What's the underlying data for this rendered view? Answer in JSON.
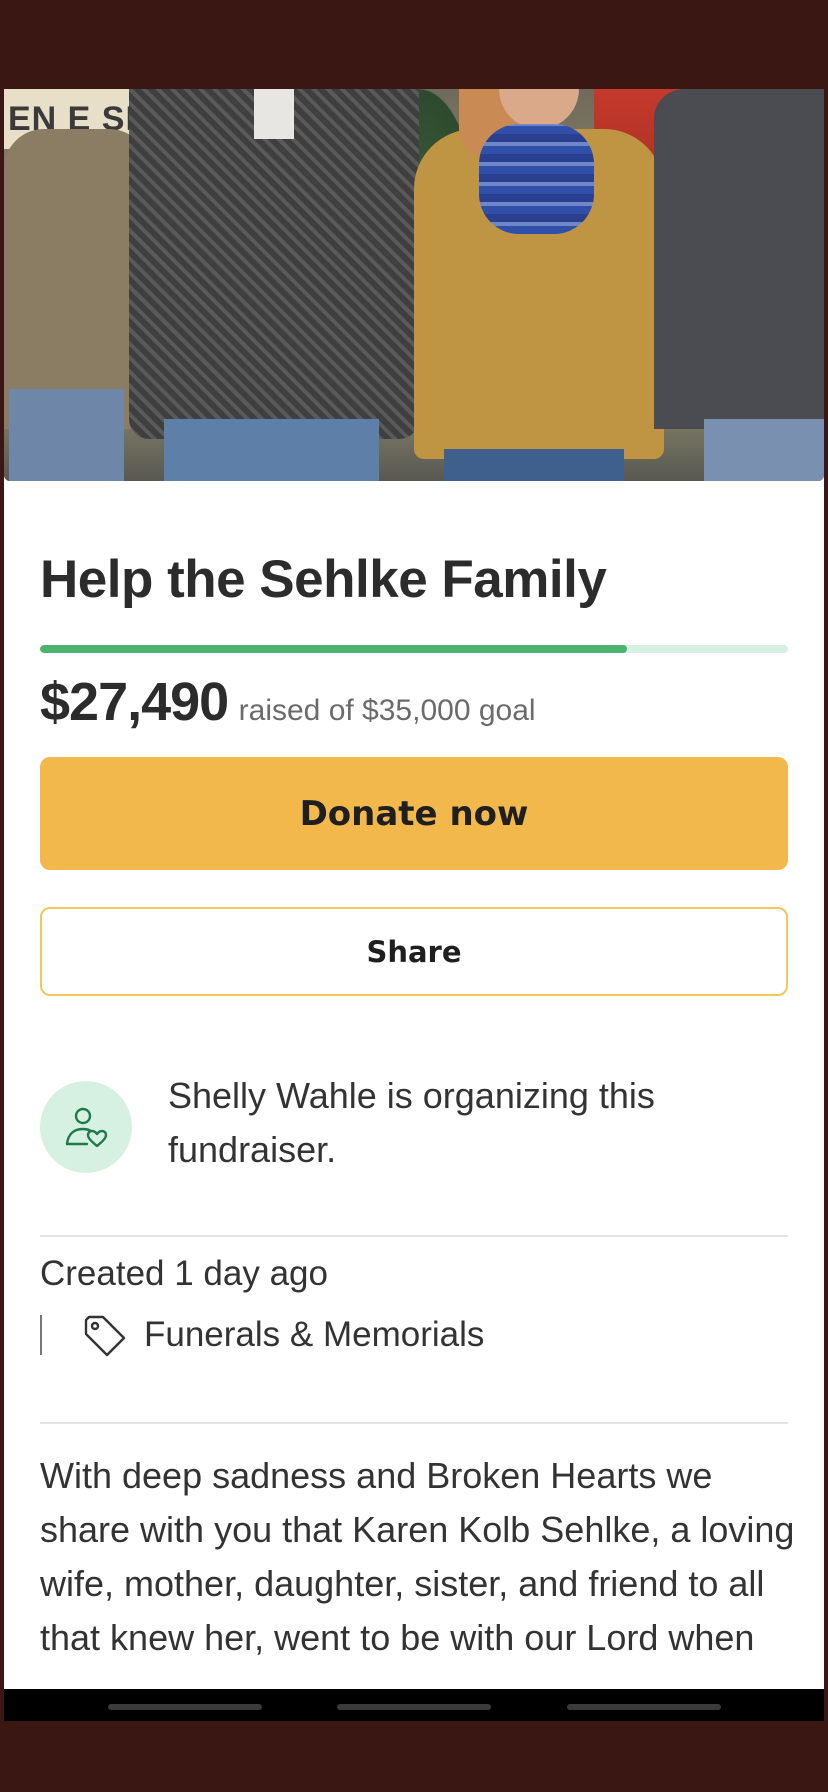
{
  "hero": {
    "sign_text": "EN E SH"
  },
  "campaign": {
    "title": "Help the Sehlke Family",
    "progress": 0.785,
    "amount_raised": "$27,490",
    "goal_text": "raised of $35,000 goal"
  },
  "actions": {
    "donate_label": "Donate now",
    "share_label": "Share"
  },
  "organizer": {
    "text": "Shelly Wahle is organizing this fundraiser.",
    "icon": "person-heart-icon"
  },
  "meta": {
    "created": "Created 1 day ago",
    "category": "Funerals & Memorials",
    "category_icon": "tag-icon"
  },
  "story": {
    "text": "With deep sadness and Broken Hearts we share with you that Karen Kolb Sehlke, a loving wife, mother, daughter, sister, and friend to all that knew her, went to be with our Lord when"
  },
  "colors": {
    "accent_green": "#4db26f",
    "donate_yellow": "#f2b84b",
    "avatar_bg": "#d6f1e1"
  }
}
